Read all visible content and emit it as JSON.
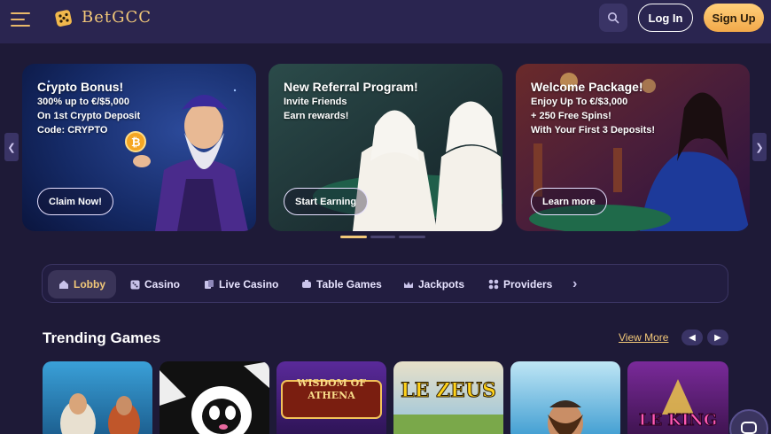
{
  "brand": {
    "name": "BetGCC"
  },
  "header": {
    "login_label": "Log In",
    "signup_label": "Sign Up"
  },
  "icons": {
    "menu": "hamburger-icon",
    "search": "search-icon",
    "chat": "chat-icon"
  },
  "colors": {
    "accent": "#f2c879",
    "background": "#1e1a37",
    "header": "#2a2550"
  },
  "banners": [
    {
      "title": "Crypto Bonus!",
      "lines": [
        "300% up to €/$5,000",
        "On 1st Crypto Deposit",
        "Code: CRYPTO"
      ],
      "cta": "Claim Now!"
    },
    {
      "title": "New Referral Program!",
      "lines": [
        "Invite Friends",
        "Earn rewards!"
      ],
      "cta": "Start Earning"
    },
    {
      "title": "Welcome Package!",
      "lines": [
        "Enjoy Up To €/$3,000",
        "+ 250 Free Spins!",
        "With Your First 3 Deposits!"
      ],
      "cta": "Learn more"
    }
  ],
  "carousel": {
    "active_index": 0,
    "count": 3
  },
  "categories": [
    {
      "label": "Lobby",
      "icon": "home-icon",
      "active": true
    },
    {
      "label": "Casino",
      "icon": "dice-icon"
    },
    {
      "label": "Live Casino",
      "icon": "live-cards-icon"
    },
    {
      "label": "Table Games",
      "icon": "table-icon"
    },
    {
      "label": "Jackpots",
      "icon": "crown-icon"
    },
    {
      "label": "Providers",
      "icon": "grid-dots-icon"
    }
  ],
  "trending": {
    "title": "Trending Games",
    "view_more": "View More",
    "games": [
      {
        "name": ""
      },
      {
        "name": ""
      },
      {
        "name": "WISDOM OF ATHENA"
      },
      {
        "name": "LE ZEUS"
      },
      {
        "name": ""
      },
      {
        "name": "LE KING"
      }
    ]
  }
}
